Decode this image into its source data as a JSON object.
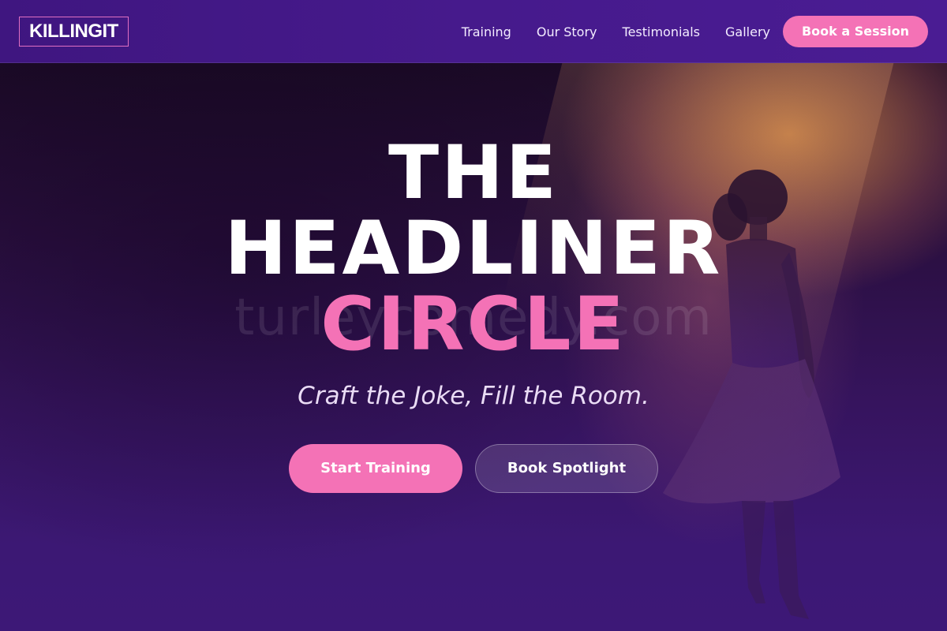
{
  "colors": {
    "accent": "#f472b6",
    "header_bg": "#461a8c",
    "hero_bg": "#3c1874",
    "text_light": "#ffffff"
  },
  "header": {
    "logo_text": "KILLINGIT",
    "nav_items": [
      {
        "label": "Training"
      },
      {
        "label": "Our Story"
      },
      {
        "label": "Testimonials"
      },
      {
        "label": "Gallery"
      }
    ],
    "cta_label": "Book a Session"
  },
  "hero": {
    "headline_lines": [
      "THE",
      "HEADLINER",
      "CIRCLE"
    ],
    "watermark": "turleycomedy.com",
    "tagline": "Craft the Joke, Fill the Room.",
    "primary_button": "Start Training",
    "secondary_button": "Book Spotlight",
    "background_image": "performer-silhouette-on-stage"
  }
}
